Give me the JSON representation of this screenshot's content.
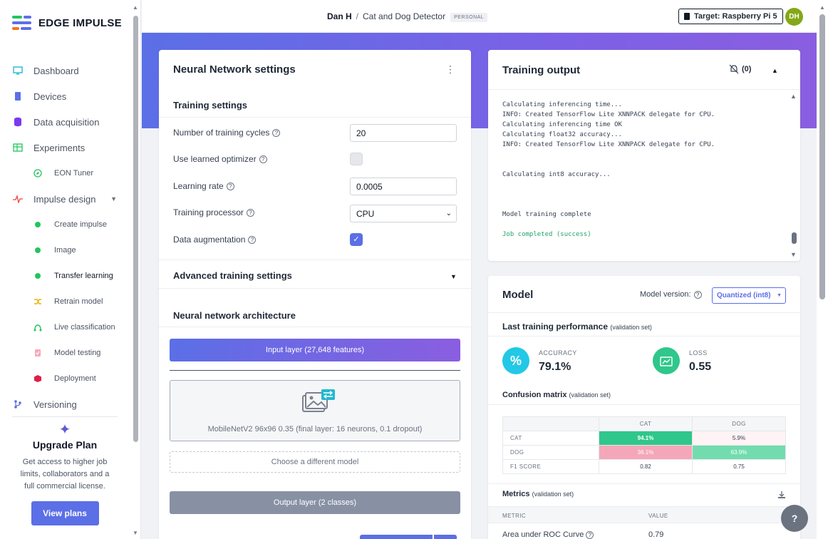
{
  "app": {
    "name": "EDGE IMPULSE"
  },
  "colors": {
    "accent": "#5b6fe6",
    "success": "#22c55e",
    "cm_correct": "#2fc78b",
    "cm_wrong": "#f4a7b9"
  },
  "sidebar": {
    "items": [
      {
        "label": "Dashboard",
        "icon": "monitor-icon"
      },
      {
        "label": "Devices",
        "icon": "chip-icon"
      },
      {
        "label": "Data acquisition",
        "icon": "database-icon"
      },
      {
        "label": "Experiments",
        "icon": "table-icon"
      },
      {
        "label": "EON Tuner",
        "icon": "compass-icon",
        "sub": true
      },
      {
        "label": "Impulse design",
        "icon": "pulse-icon"
      },
      {
        "label": "Create impulse",
        "sub": true,
        "dot": true
      },
      {
        "label": "Image",
        "sub": true,
        "dot": true
      },
      {
        "label": "Transfer learning",
        "sub": true,
        "dot": true,
        "active": true
      },
      {
        "label": "Retrain model",
        "icon": "shuffle-icon",
        "sub": true
      },
      {
        "label": "Live classification",
        "icon": "route-icon",
        "sub": true
      },
      {
        "label": "Model testing",
        "icon": "clipboard-icon",
        "sub": true
      },
      {
        "label": "Deployment",
        "icon": "cube-icon",
        "sub": true
      },
      {
        "label": "Versioning",
        "icon": "branch-icon"
      }
    ],
    "upgrade": {
      "title": "Upgrade Plan",
      "line1": "Get access to higher job",
      "line2": "limits, collaborators and a",
      "line3": "full commercial license.",
      "button": "View plans"
    }
  },
  "topbar": {
    "user": "Dan H",
    "sep": "/",
    "project": "Cat and Dog Detector",
    "badge": "PERSONAL",
    "target": "Target: Raspberry Pi 5",
    "avatar": "DH"
  },
  "nn": {
    "title": "Neural Network settings",
    "training_title": "Training settings",
    "cycles_label": "Number of training cycles",
    "cycles_value": "20",
    "optimizer_label": "Use learned optimizer",
    "lr_label": "Learning rate",
    "lr_value": "0.0005",
    "processor_label": "Training processor",
    "processor_value": "CPU",
    "augmentation_label": "Data augmentation",
    "advanced_title": "Advanced training settings",
    "arch_title": "Neural network architecture",
    "input_layer": "Input layer (27,648 features)",
    "model_name": "MobileNetV2 96x96 0.35 (final layer: 16 neurons, 0.1 dropout)",
    "choose_model": "Choose a different model",
    "output_layer": "Output layer (2 classes)",
    "help": "?"
  },
  "output": {
    "title": "Training output",
    "notif_count": "(0)",
    "lines": [
      "Calculating inferencing time...",
      "INFO: Created TensorFlow Lite XNNPACK delegate for CPU.",
      "Calculating inferencing time OK",
      "Calculating float32 accuracy...",
      "INFO: Created TensorFlow Lite XNNPACK delegate for CPU.",
      "",
      "",
      "Calculating int8 accuracy...",
      "",
      "",
      "",
      "Model training complete",
      "",
      "Job completed (success)"
    ]
  },
  "model": {
    "title": "Model",
    "version_label": "Model version:",
    "version_value": "Quantized (int8)",
    "perf_title": "Last training performance",
    "perf_sub": "(validation set)",
    "accuracy_label": "ACCURACY",
    "accuracy_value": "79.1%",
    "loss_label": "LOSS",
    "loss_value": "0.55",
    "accuracy_glyph": "%",
    "cm_title": "Confusion matrix",
    "cm_sub": "(validation set)",
    "cm": {
      "cols": [
        "CAT",
        "DOG"
      ],
      "rows": [
        {
          "label": "CAT",
          "values": [
            "94.1%",
            "5.9%"
          ]
        },
        {
          "label": "DOG",
          "values": [
            "36.1%",
            "63.9%"
          ]
        },
        {
          "label": "F1 SCORE",
          "values": [
            "0.82",
            "0.75"
          ]
        }
      ]
    },
    "metrics_title": "Metrics",
    "metrics_sub": "(validation set)",
    "metrics_cols": [
      "METRIC",
      "VALUE"
    ],
    "metrics_rows": [
      {
        "metric": "Area under ROC Curve",
        "value": "0.79"
      }
    ]
  },
  "fab": "?"
}
